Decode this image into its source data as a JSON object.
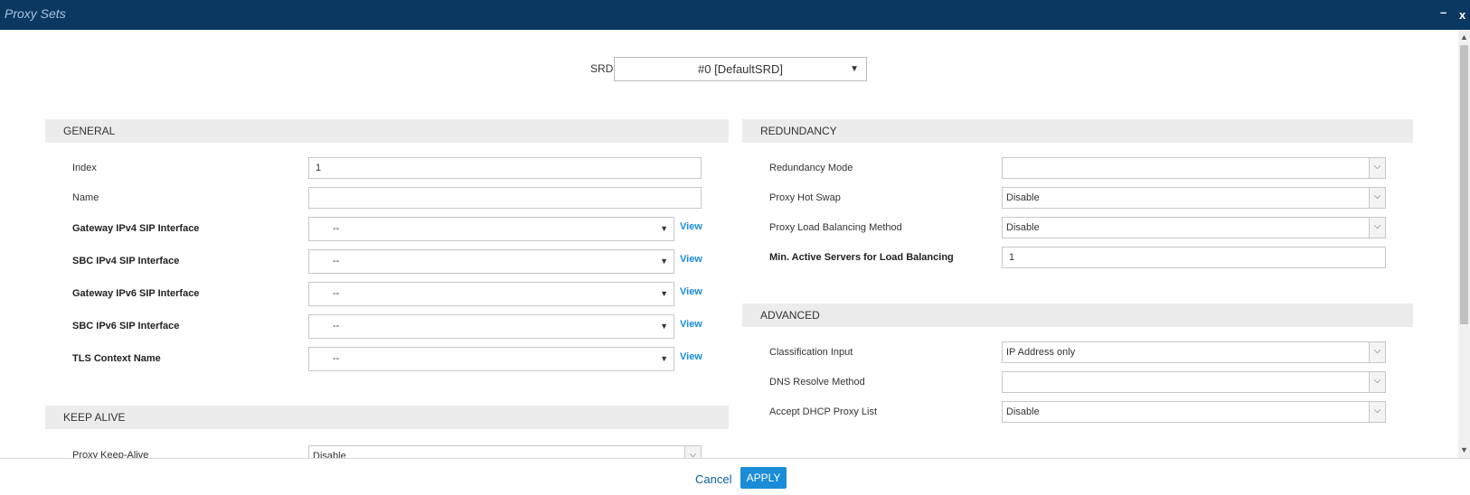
{
  "window": {
    "title": "Proxy Sets",
    "minimize_glyph": "–",
    "close_glyph": "x"
  },
  "srd": {
    "label": "SRD",
    "value": "#0 [DefaultSRD]"
  },
  "general": {
    "header": "GENERAL",
    "index_label": "Index",
    "index_value": "1",
    "name_label": "Name",
    "name_value": "",
    "gw_ipv4_label": "Gateway IPv4 SIP Interface",
    "gw_ipv4_value": "--",
    "sbc_ipv4_label": "SBC IPv4 SIP Interface",
    "sbc_ipv4_value": "--",
    "gw_ipv6_label": "Gateway IPv6 SIP Interface",
    "gw_ipv6_value": "--",
    "sbc_ipv6_label": "SBC IPv6 SIP Interface",
    "sbc_ipv6_value": "--",
    "tls_label": "TLS Context Name",
    "tls_value": "--",
    "view_label": "View"
  },
  "keep_alive": {
    "header": "KEEP ALIVE",
    "proxy_keep_alive_label": "Proxy Keep-Alive",
    "proxy_keep_alive_value": "Disable"
  },
  "redundancy": {
    "header": "REDUNDANCY",
    "mode_label": "Redundancy Mode",
    "mode_value": "",
    "hot_swap_label": "Proxy Hot Swap",
    "hot_swap_value": "Disable",
    "lb_method_label": "Proxy Load Balancing Method",
    "lb_method_value": "Disable",
    "min_active_label": "Min. Active Servers for Load Balancing",
    "min_active_value": "1"
  },
  "advanced": {
    "header": "ADVANCED",
    "classification_label": "Classification Input",
    "classification_value": "IP Address only",
    "dns_label": "DNS Resolve Method",
    "dns_value": "",
    "dhcp_label": "Accept DHCP Proxy List",
    "dhcp_value": "Disable"
  },
  "footer": {
    "cancel_label": "Cancel",
    "apply_label": "APPLY"
  },
  "icons": {
    "dropdown": "▼",
    "select_chevron": "⌵",
    "scroll_up": "▲",
    "scroll_down": "▼"
  },
  "colors": {
    "titlebar": "#0b3861",
    "accent": "#1a8cd8",
    "section_bg": "#ececec"
  }
}
